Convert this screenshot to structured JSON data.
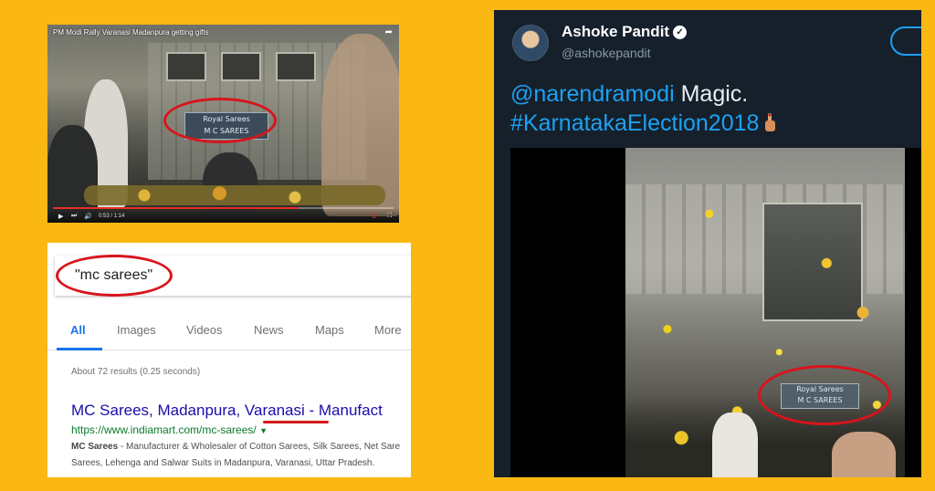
{
  "video": {
    "title": "PM Modi Rally Varanasi Madanpura getting gifts",
    "sign_line1": "Royal Sarees",
    "sign_line2": "M C SAREES",
    "time": "0:53 / 1:14",
    "progress": 0.72
  },
  "search": {
    "query": "\"mc sarees\"",
    "tabs": [
      "All",
      "Images",
      "Videos",
      "News",
      "Maps",
      "More"
    ],
    "active_tab": "All",
    "stats": "About 72 results (0.25 seconds)",
    "result": {
      "title_part1": "MC Sarees, Madanpura, ",
      "title_highlight": "Varanasi",
      "title_part2": " - Manufact",
      "url": "https://www.indiamart.com/mc-sarees/",
      "snippet_bold": "MC Sarees",
      "snippet_line1": " - Manufacturer & Wholesaler of Cotton Sarees, Silk Sarees, Net Sare",
      "snippet_line2": "Sarees, Lehenga and Salwar Suits in Madanpura, Varanasi, Uttar Pradesh."
    }
  },
  "tweet": {
    "name": "Ashoke Pandit",
    "handle": "@ashokepandit",
    "mention": "@narendramodi",
    "text_after_mention": " Magic.",
    "hashtag": "#KarnatakaElection2018",
    "sign_line1": "Royal Sarees",
    "sign_line2": "M C SAREES"
  },
  "colors": {
    "background": "#FBB812",
    "highlight_ring": "#d8141c",
    "link_blue": "#1da1f2",
    "google_blue": "#1a0dab",
    "google_green": "#0b7a2d"
  }
}
